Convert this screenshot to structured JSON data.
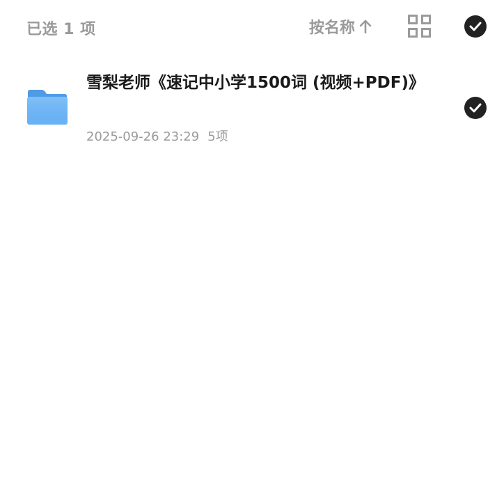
{
  "header": {
    "selected_text": "已选 1 项",
    "sort_label": "按名称",
    "sort_icon": "arrow-up-icon",
    "view_icon": "grid-view-icon",
    "select_all_icon": "check-circle-icon"
  },
  "files": [
    {
      "name": "雪梨老师《速记中小学1500词 (视频+PDF)》",
      "date": "2025-09-26 23:29",
      "count": "5项",
      "type_icon": "folder-icon",
      "selected": true
    }
  ],
  "colors": {
    "muted": "#9a9a9a",
    "check_bg": "#222222",
    "folder": "#5aa7f0"
  }
}
